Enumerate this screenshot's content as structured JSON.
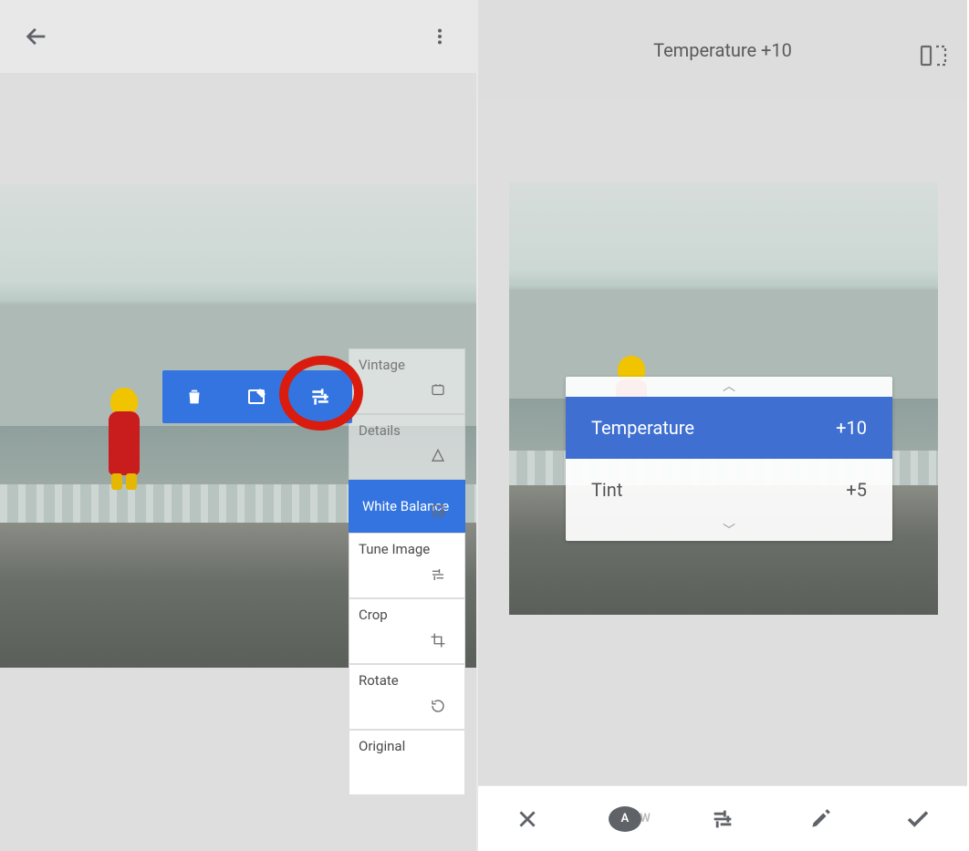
{
  "left": {
    "toolbar": {
      "items": [
        "delete",
        "brush-edit",
        "tune"
      ]
    },
    "history": [
      {
        "label": "Vintage"
      },
      {
        "label": "Details"
      },
      {
        "label": "White Balance",
        "active": true
      },
      {
        "label": "Tune Image"
      },
      {
        "label": "Crop"
      },
      {
        "label": "Rotate"
      },
      {
        "label": "Original"
      }
    ]
  },
  "right": {
    "header": {
      "title": "Temperature +10"
    },
    "adjustments": [
      {
        "name": "Temperature",
        "value": "+10",
        "selected": true
      },
      {
        "name": "Tint",
        "value": "+5",
        "selected": false
      }
    ],
    "bottom_icons": [
      "close",
      "auto-wb",
      "tune",
      "eyedropper",
      "apply"
    ]
  }
}
